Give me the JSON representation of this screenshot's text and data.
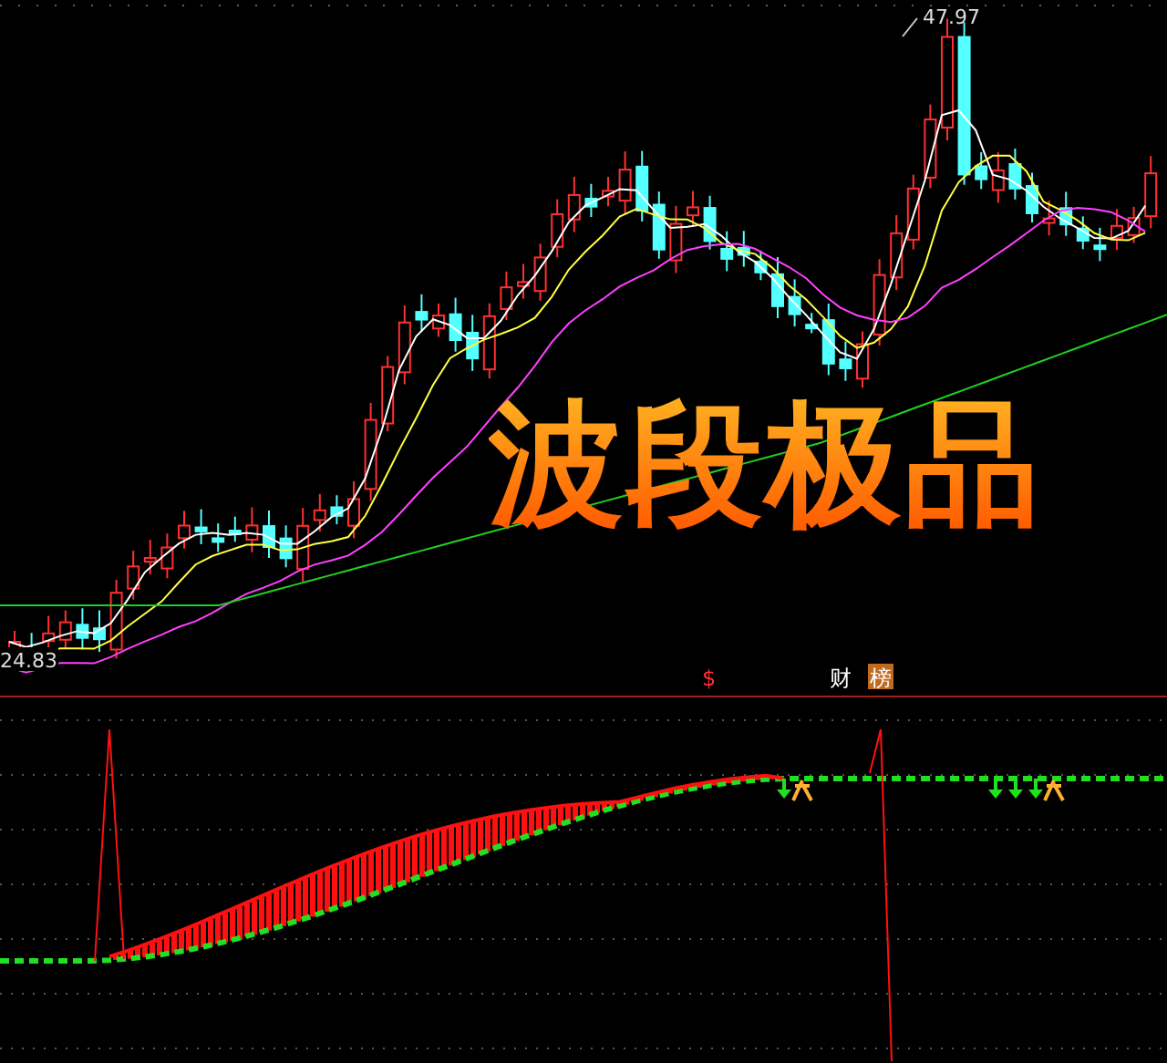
{
  "price_panel": {
    "high_label": "47.97",
    "low_label": "24.83",
    "overlay_title": "波段极品"
  },
  "marker_row": [
    {
      "kind": "dollar",
      "text": "$"
    },
    {
      "kind": "finance",
      "text": "财"
    },
    {
      "kind": "rank",
      "text": "榜"
    }
  ]
}
